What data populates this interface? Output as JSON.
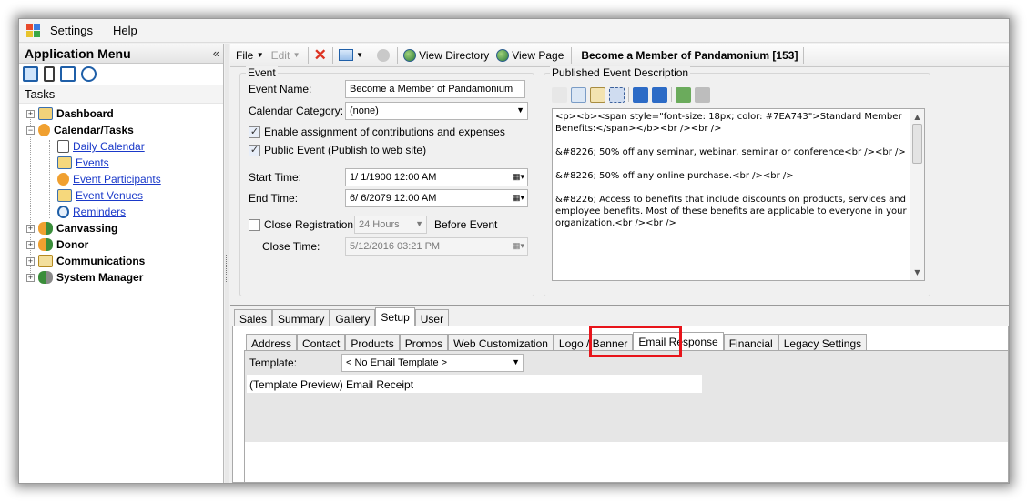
{
  "menubar": {
    "items": [
      "Settings",
      "Help"
    ]
  },
  "sidebar": {
    "title": "Application Menu",
    "collapse_glyph": "«",
    "tasks_label": "Tasks",
    "nodes": [
      {
        "label": "Dashboard"
      },
      {
        "label": "Calendar/Tasks"
      },
      {
        "label": "Daily Calendar"
      },
      {
        "label": "Events"
      },
      {
        "label": "Event Participants"
      },
      {
        "label": "Event Venues"
      },
      {
        "label": "Reminders"
      },
      {
        "label": "Canvassing"
      },
      {
        "label": "Donor"
      },
      {
        "label": "Communications"
      },
      {
        "label": "System Manager"
      }
    ]
  },
  "toolbar": {
    "file": "File",
    "edit": "Edit",
    "view_directory": "View Directory",
    "view_page": "View Page",
    "title": "Become a Member of Pandamonium [153]"
  },
  "event": {
    "group_title": "Event",
    "name_label": "Event Name:",
    "name_value": "Become a Member of Pandamonium",
    "category_label": "Calendar Category:",
    "category_value": "(none)",
    "enable_assignment": "Enable assignment of contributions and expenses",
    "public_event": "Public Event (Publish to web site)",
    "start_label": "Start Time:",
    "start_value": "1/ 1/1900 12:00 AM",
    "end_label": "End Time:",
    "end_value": "6/ 6/2079 12:00 AM",
    "close_reg_label": "Close Registration",
    "close_reg_value": "24 Hours",
    "before_event": "Before Event",
    "close_time_label": "Close Time:",
    "close_time_value": "5/12/2016 03:21 PM"
  },
  "description": {
    "group_title": "Published Event Description",
    "paragraphs": [
      "<p><b><span style=\"font-size: 18px; color: #7EA743\">Standard Member Benefits:</span></b><br /><br />",
      "&#8226; 50% off any seminar, webinar, seminar or conference<br /><br />",
      "&#8226; 50% off any online purchase.<br /><br />",
      "&#8226; Access to benefits that include discounts on products, services and employee benefits. Most of these benefits are applicable to everyone in your organization.<br /><br />"
    ]
  },
  "tabs_main": [
    "Sales",
    "Summary",
    "Gallery",
    "Setup",
    "User"
  ],
  "tabs_setup": [
    "Address",
    "Contact",
    "Products",
    "Promos",
    "Web Customization",
    "Logo / Banner",
    "Email Response",
    "Financial",
    "Legacy Settings"
  ],
  "email": {
    "template_label": "Template:",
    "template_value": "< No Email Template >",
    "preview_text": "(Template Preview) Email Receipt"
  },
  "colors": {
    "highlight": "#e8141a",
    "link": "#1a39c9"
  }
}
